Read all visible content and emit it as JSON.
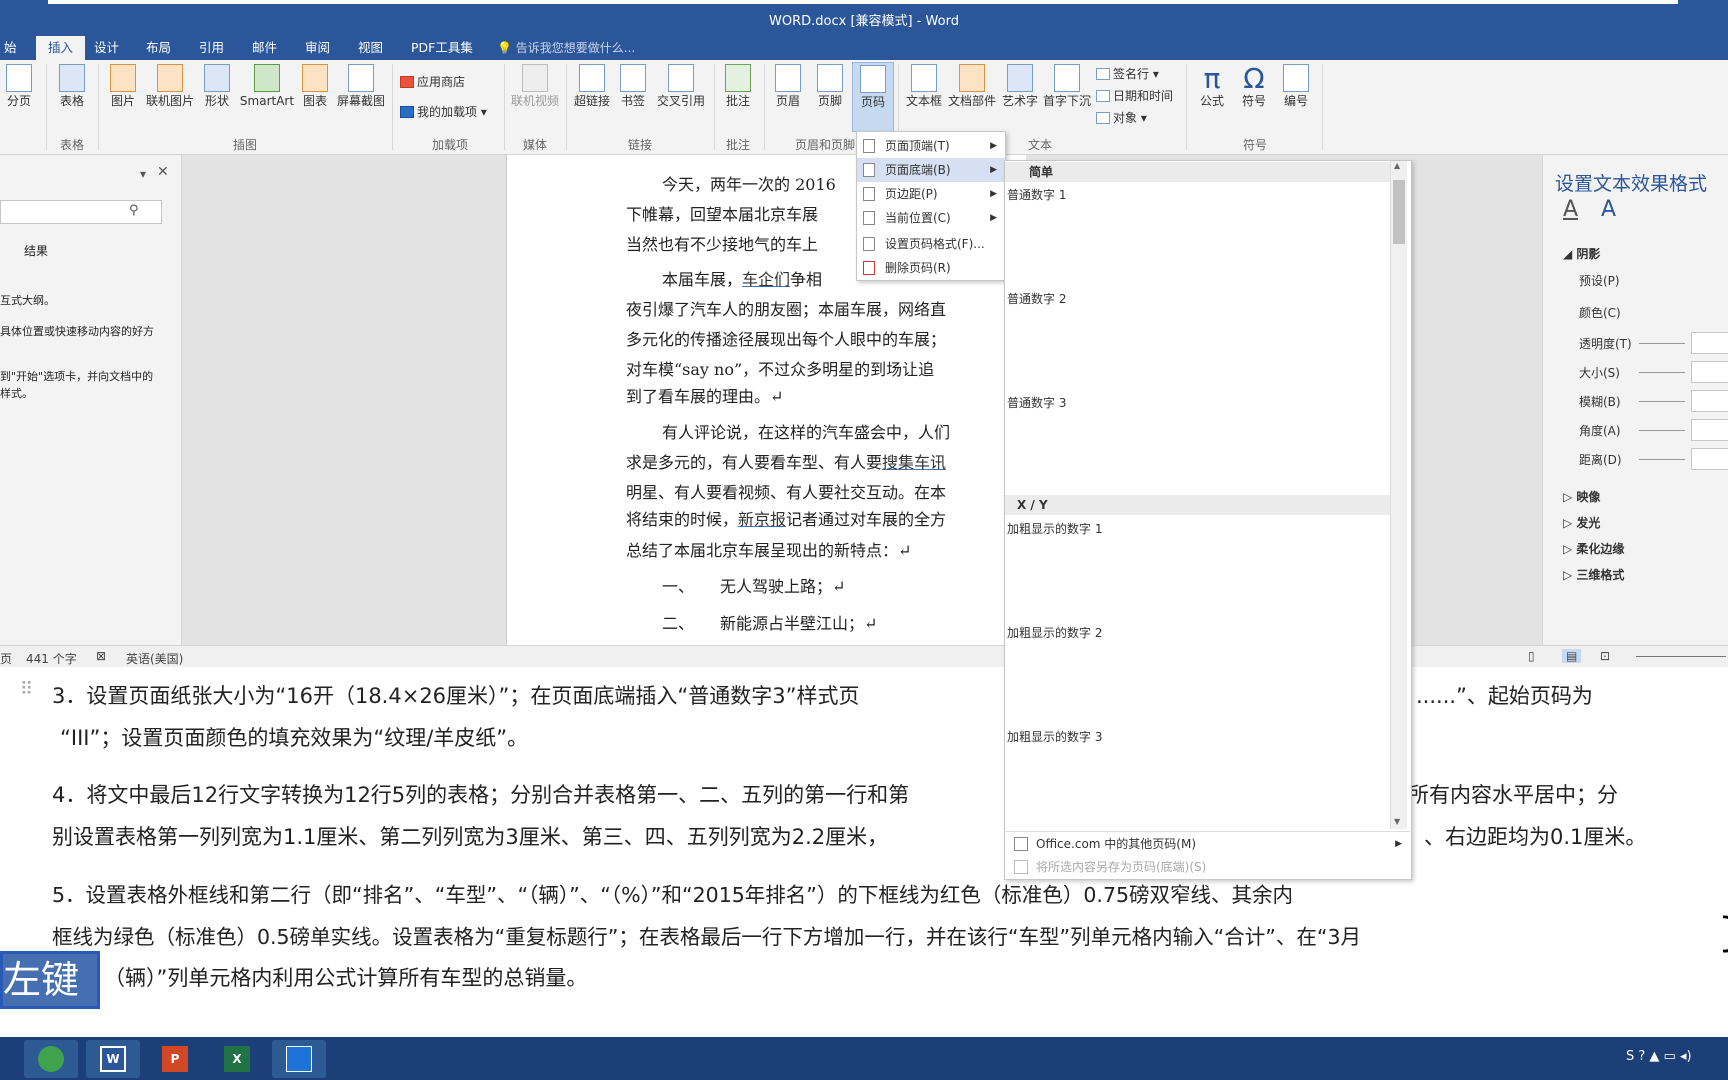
{
  "window": {
    "title": "WORD.docx [兼容模式] - Word"
  },
  "tabs": [
    {
      "label": "始",
      "active": false
    },
    {
      "label": "插入",
      "active": true
    },
    {
      "label": "设计",
      "active": false
    },
    {
      "label": "布局",
      "active": false
    },
    {
      "label": "引用",
      "active": false
    },
    {
      "label": "邮件",
      "active": false
    },
    {
      "label": "审阅",
      "active": false
    },
    {
      "label": "视图",
      "active": false
    },
    {
      "label": "PDF工具集",
      "active": false
    }
  ],
  "tell_me": "告诉我您想要做什么...",
  "ribbon": {
    "pages": {
      "fenye": "分页"
    },
    "table": {
      "biaoge": "表格",
      "group": "表格"
    },
    "illustrations": {
      "tupian": "图片",
      "lianji": "联机图片",
      "xingzhuang": "形状",
      "smartart": "SmartArt",
      "tubiao": "图表",
      "jietu": "屏幕截图",
      "group": "插图"
    },
    "addins": {
      "store": "应用商店",
      "my": "我的加载项",
      "group": "加载项"
    },
    "media": {
      "video": "联机视频",
      "group": "媒体"
    },
    "links": {
      "hyperlink": "超链接",
      "bookmark": "书签",
      "crossref": "交叉引用",
      "group": "链接"
    },
    "comments": {
      "comment": "批注",
      "group": "批注"
    },
    "headerfooter": {
      "header": "页眉",
      "footer": "页脚",
      "pagenum": "页码",
      "group": "页眉和页脚"
    },
    "text": {
      "textbox": "文本框",
      "parts": "文档部件",
      "wordart": "艺术字",
      "dropcap": "首字下沉",
      "sigline": "签名行",
      "datetime": "日期和时间",
      "object": "对象",
      "group": "文本"
    },
    "symbols": {
      "equation": "公式",
      "symbol": "符号",
      "number": "编号",
      "group": "符号"
    }
  },
  "nav": {
    "results": "结果",
    "line1": "互式大纲。",
    "line2": "具体位置或快速移动内容的好方",
    "line3": "到\"开始\"选项卡，并向文档中的",
    "line4": "样式。"
  },
  "document": {
    "l1": "今天，两年一次的 2016",
    "l2": "下帷幕，回望本届北京车展",
    "l3": "当然也有不少接地气的车上",
    "l4a": "本届车展，",
    "l4b": "车企们",
    "l4c": "争相",
    "l5": "夜引爆了汽车人的朋友圈；本届车展，网络直",
    "l6": "多元化的传播途径展现出每个人眼中的车展；",
    "l7": "对车模“say no”，不过众多明星的到场让追",
    "l8": "到了看车展的理由。↵",
    "l9": "有人评论说，在这样的汽车盛会中，人们",
    "l10a": "求是多元的，有人要看车型、有人要",
    "l10b": "搜集车讯",
    "l11": "明星、有人要看视频、有人要社交互动。在本",
    "l12a": "将结束的时候，",
    "l12b": "新京报",
    "l12c": "记者通过对车展的全方",
    "l13": "总结了本届北京车展呈现出的新特点：↵",
    "item1_num": "一、",
    "item1": "无人驾驶上路；↵",
    "item2_num": "二、",
    "item2": "新能源占半壁江山；↵"
  },
  "right_pane": {
    "title": "设置文本效果格式",
    "section": "阴影",
    "preset": "预设(P)",
    "color": "颜色(C)",
    "transparency": "透明度(T)",
    "size": "大小(S)",
    "blur": "模糊(B)",
    "angle": "角度(A)",
    "distance": "距离(D)",
    "reflection": "映像",
    "glow": "发光",
    "soft_edges": "柔化边缘",
    "3d": "三维格式"
  },
  "status": {
    "page": "页",
    "words": "441 个字",
    "lang": "英语(美国)"
  },
  "page_number_menu": [
    {
      "label": "页面顶端(T)",
      "highlight": false,
      "submenu": true,
      "disabled": false
    },
    {
      "label": "页面底端(B)",
      "highlight": true,
      "submenu": true,
      "disabled": false
    },
    {
      "label": "页边距(P)",
      "highlight": false,
      "submenu": true,
      "disabled": false
    },
    {
      "label": "当前位置(C)",
      "highlight": false,
      "submenu": true,
      "disabled": false
    },
    {
      "label": "设置页码格式(F)...",
      "highlight": false,
      "submenu": false,
      "disabled": false
    },
    {
      "label": "删除页码(R)",
      "highlight": false,
      "submenu": false,
      "disabled": false
    }
  ],
  "gallery": {
    "header1": "简单",
    "header2": "X / Y",
    "items": [
      "普通数字 1",
      "普通数字 2",
      "普通数字 3",
      "加粗显示的数字 1",
      "加粗显示的数字 2",
      "加粗显示的数字 3"
    ],
    "more": "Office.com 中的其他页码(M)",
    "save": "将所选内容另存为页码(底端)(S)"
  },
  "instructions": {
    "i3a": "3．设置页面纸张大小为“16开（18.4×26厘米）”；在页面底端插入“普通数字3”样式页",
    "i3b": "......”、起始页码为",
    "i3c": "“III”；设置页面颜色的填充效果为“纹理/羊皮纸”。",
    "i4a": "4．将文中最后12行文字转换为12行5列的表格；分别合并表格第一、二、五列的第一行和第",
    "i4b": "所有内容水平居中；分",
    "i4c": "别设置表格第一列列宽为1.1厘米、第二列列宽为3厘米、第三、四、五列列宽为2.2厘米，",
    "i4d": "、右边距均为0.1厘米。",
    "i5a": "5．设置表格外框线和第二行（即“排名”、“车型”、“（辆）”、“（%）”和“2015年排名”）的下框线为红色（标准色）0.75磅双窄线、其余内",
    "i5b": "框线为绿色（标准色）0.5磅单实线。设置表格为“重复标题行”；在表格最后一行下方增加一行，并在该行“车型”列单元格内输入“合计”、在“3月",
    "i5c": "（辆）”列单元格内利用公式计算所有车型的总销量。"
  },
  "key_badge": "左键>",
  "colors": {
    "word_blue": "#2b579a",
    "ribbon_bg": "#f3f3f3",
    "taskbar": "#1c3f78"
  }
}
